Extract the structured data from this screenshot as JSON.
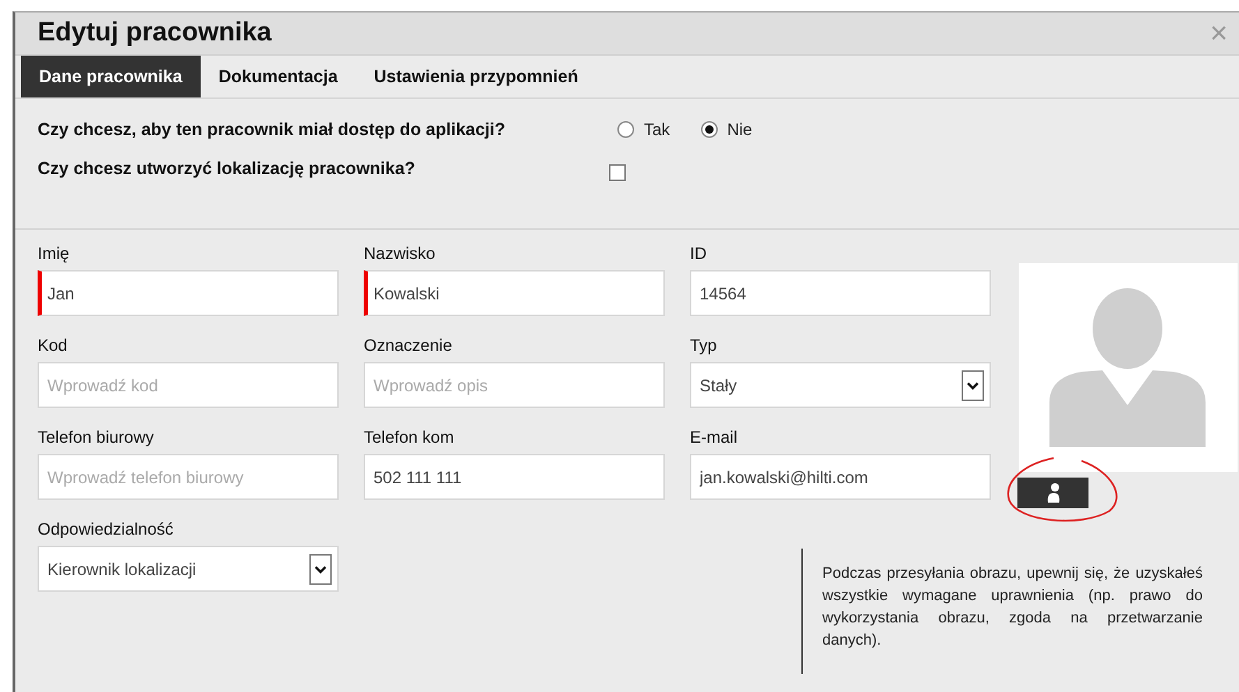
{
  "window": {
    "title": "Edytuj pracownika",
    "close": "×"
  },
  "tabs": [
    {
      "label": "Dane pracownika",
      "selected": true
    },
    {
      "label": "Dokumentacja",
      "selected": false
    },
    {
      "label": "Ustawienia przypomnień",
      "selected": false
    }
  ],
  "questions": [
    {
      "kind": "radio",
      "label": "Czy chcesz, aby ten pracownik miał dostęp do aplikacji?",
      "options": [
        {
          "label": "Tak",
          "selected": false
        },
        {
          "label": "Nie",
          "selected": true
        }
      ]
    },
    {
      "kind": "checkbox",
      "label": "Czy chcesz utworzyć lokalizację pracownika?",
      "checked": false
    }
  ],
  "fields": [
    {
      "kind": "text",
      "label": "Imię",
      "value": "Jan",
      "required": true
    },
    {
      "kind": "text",
      "label": "Nazwisko",
      "value": "Kowalski",
      "required": true
    },
    {
      "kind": "text",
      "label": "ID",
      "value": "14564"
    },
    {
      "kind": "text",
      "label": "Kod",
      "placeholder": "Wprowadź kod"
    },
    {
      "kind": "text",
      "label": "Oznaczenie",
      "placeholder": "Wprowadź opis"
    },
    {
      "kind": "select",
      "label": "Typ",
      "value": "Stały"
    },
    {
      "kind": "text",
      "label": "Telefon biurowy",
      "placeholder": "Wprowadź telefon biurowy"
    },
    {
      "kind": "text",
      "label": "Telefon kom",
      "value": "502 111 111"
    },
    {
      "kind": "text",
      "label": "E-mail",
      "value": "jan.kowalski@hilti.com"
    },
    {
      "kind": "select",
      "label": "Odpowiedzialność",
      "value": "Kierownik lokalizacji"
    }
  ],
  "notice": "Podczas przesyłania obrazu, upewnij się, że uzyskałeś wszystkie wymagane uprawnienia (np. prawo do wykorzystania obrazu, zgoda na przetwarzanie danych)."
}
